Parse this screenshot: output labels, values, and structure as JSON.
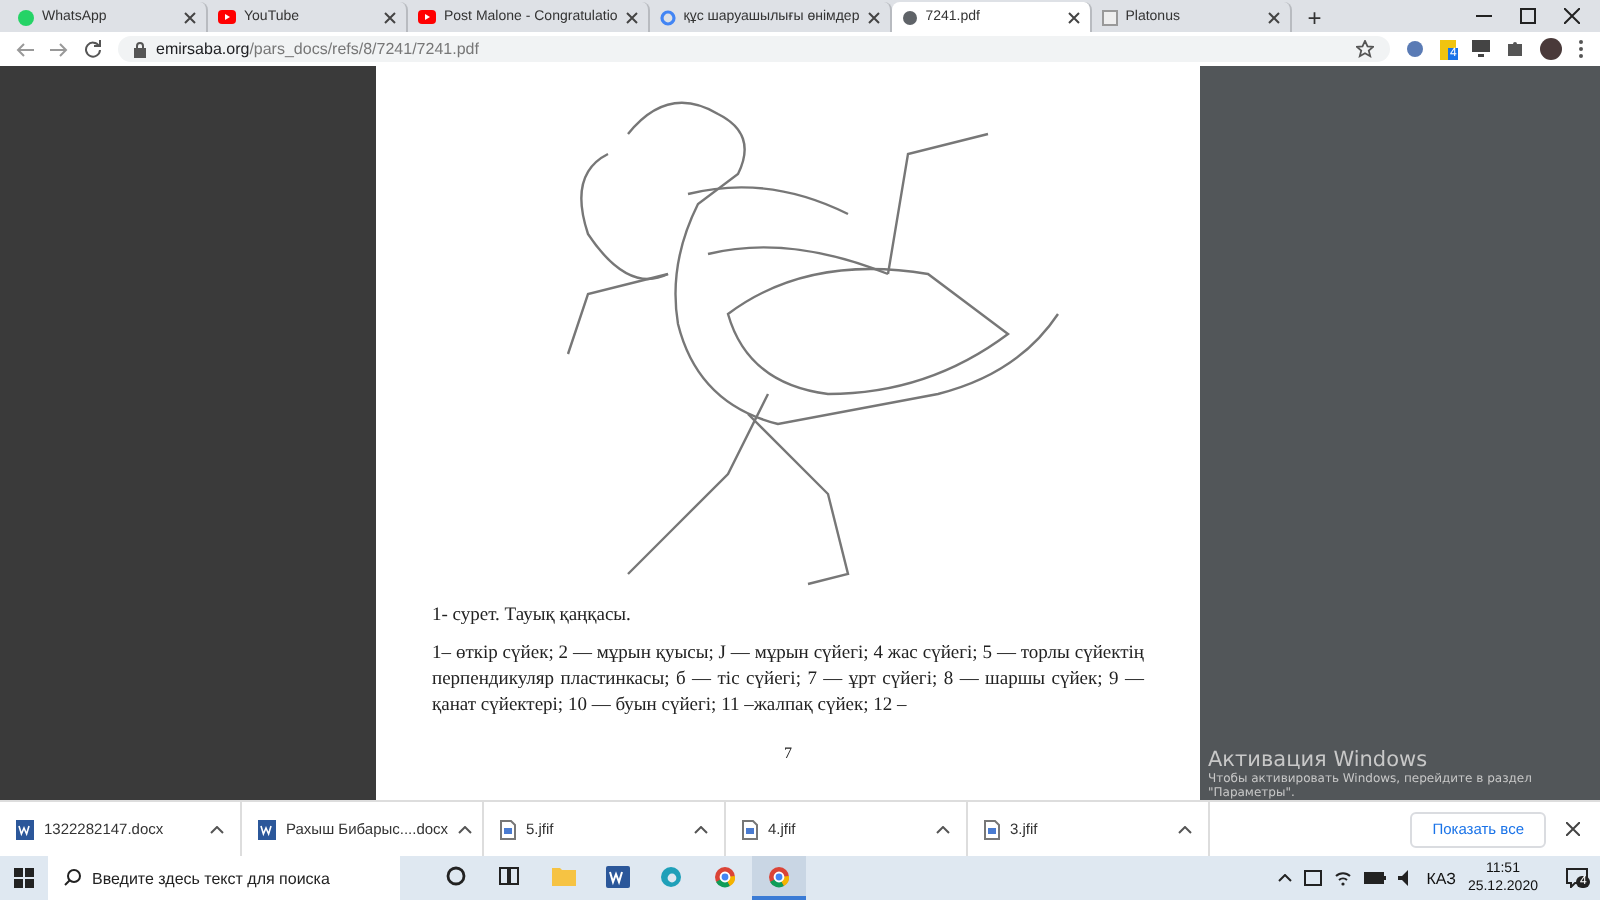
{
  "tabs": [
    {
      "title": "WhatsApp",
      "kind": "whatsapp",
      "selected": false
    },
    {
      "title": "YouTube",
      "kind": "youtube",
      "selected": false
    },
    {
      "title": "Post Malone - Congratulatio",
      "kind": "youtube",
      "selected": false
    },
    {
      "title": "құс шаруашылығы өнімдер",
      "kind": "google",
      "selected": false
    },
    {
      "title": "7241.pdf",
      "kind": "globe",
      "selected": true
    },
    {
      "title": "Platonus",
      "kind": "page",
      "selected": false
    }
  ],
  "new_tab": "+",
  "address": {
    "domain": "emirsaba.org",
    "path": "/pars_docs/refs/8/7241/7241.pdf"
  },
  "extension_badge": "4",
  "document": {
    "caption": "1- сурет. Тауық қаңқасы.",
    "paragraph": "1– өткір сүйек; 2 — мұрын қуысы; J — мұрын сүйегі; 4 жас сүйегі; 5 — торлы сүйектің перпендикуляр пластинкасы; б — тіс сүйегі; 7 — ұрт сүйегі; 8 — шаршы сүйек; 9 — қанат сүйектері; 10 — буын сүйегі; 11 –жалпақ сүйек; 12 –",
    "page_number": "7"
  },
  "activation": {
    "title": "Активация Windows",
    "text": "Чтобы активировать Windows, перейдите в раздел \"Параметры\"."
  },
  "downloads": [
    {
      "name": "1322282147.docx",
      "kind": "word"
    },
    {
      "name": "Рахыш Бибарыс....docx",
      "kind": "word"
    },
    {
      "name": "5.jfif",
      "kind": "file"
    },
    {
      "name": "4.jfif",
      "kind": "file"
    },
    {
      "name": "3.jfif",
      "kind": "file"
    }
  ],
  "show_all": "Показать все",
  "taskbar": {
    "search_placeholder": "Введите здесь текст для поиска",
    "apps": [
      {
        "kind": "cortana",
        "active": false
      },
      {
        "kind": "taskview",
        "active": false
      },
      {
        "kind": "explorer",
        "active": false
      },
      {
        "kind": "word",
        "active": false
      },
      {
        "kind": "edge",
        "active": false
      },
      {
        "kind": "chrome",
        "active": false
      },
      {
        "kind": "chrome",
        "active": true
      }
    ],
    "language": "КАЗ",
    "time": "11:51",
    "date": "25.12.2020",
    "notifications": "4"
  }
}
